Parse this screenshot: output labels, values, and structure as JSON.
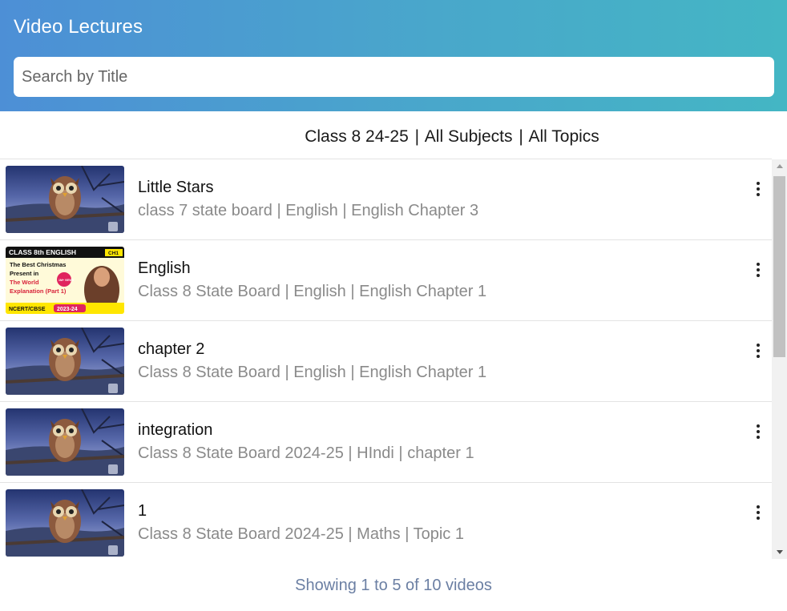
{
  "header": {
    "title": "Video Lectures",
    "search_placeholder": "Search by Title"
  },
  "filter": {
    "class": "Class 8 24-25",
    "subject": "All Subjects",
    "topic": "All Topics",
    "separator": "|"
  },
  "videos": [
    {
      "title": "Little Stars",
      "meta": [
        "class 7 state board",
        "English",
        "English Chapter 3"
      ],
      "thumbnail": "owl"
    },
    {
      "title": "English",
      "meta": [
        "Class 8 State Board",
        "English",
        "English Chapter 1"
      ],
      "thumbnail": "english-cover",
      "thumb_text": {
        "top": "CLASS 8th ENGLISH",
        "ch": "CH1",
        "line1": "The Best Christmas",
        "line2": "Present in",
        "line3": "The World",
        "line4": "Explanation (Part 1)",
        "badge": "1M+ VIEWS",
        "bottom": "NCERT/CBSE",
        "year": "2023-24"
      }
    },
    {
      "title": "chapter 2",
      "meta": [
        "Class 8 State Board",
        "English",
        "English Chapter 1"
      ],
      "thumbnail": "owl"
    },
    {
      "title": "integration",
      "meta": [
        "Class 8 State Board 2024-25",
        "HIndi",
        "chapter 1"
      ],
      "thumbnail": "owl"
    },
    {
      "title": "1",
      "meta": [
        "Class 8 State Board 2024-25",
        "Maths",
        "Topic 1"
      ],
      "thumbnail": "owl"
    }
  ],
  "footer": {
    "status": "Showing 1 to 5 of 10 videos"
  },
  "icons": {
    "menu": "more-vert-icon"
  },
  "colors": {
    "header_start": "#4d8fd6",
    "header_end": "#44b6c4",
    "meta_text": "#8a8a8a",
    "footer_text": "#6b7fa3"
  }
}
